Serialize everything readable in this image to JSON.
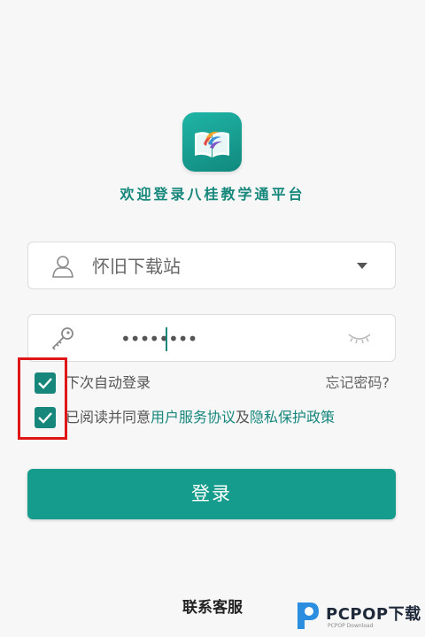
{
  "header": {
    "welcome_text": "欢迎登录八桂教学通平台"
  },
  "login_form": {
    "username_value": "怀旧下载站",
    "password_masked": "••••••••",
    "remember_label": "下次自动登录",
    "forgot_label": "忘记密码?",
    "agree_prefix": "已阅读并同意",
    "user_agreement_link": "用户服务协议",
    "agree_conjunction": "及",
    "privacy_policy_link": "隐私保护政策",
    "remember_checked": true,
    "agree_checked": true,
    "login_button_label": "登录"
  },
  "footer": {
    "contact_label": "联系客服"
  },
  "watermark": {
    "brand": "PCPOP下载",
    "sub": "PCPOP Download"
  },
  "colors": {
    "accent": "#17877c",
    "button": "#169c8d",
    "highlight": "#e01515"
  }
}
